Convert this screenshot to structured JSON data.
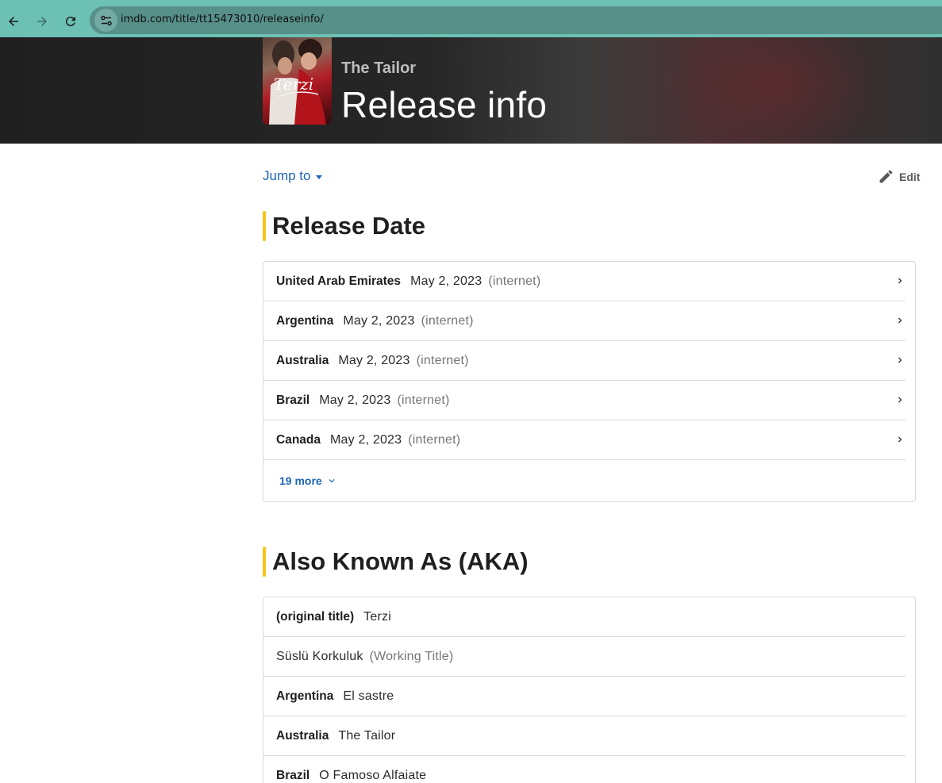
{
  "browser": {
    "url": "imdb.com/title/tt15473010/releaseinfo/",
    "icons": [
      "back-arrow-icon",
      "forward-arrow-icon",
      "reload-icon",
      "site-info-icon"
    ]
  },
  "hero": {
    "subtitle": "The Tailor",
    "title": "Release info",
    "poster_text": "Terzi"
  },
  "toolbar": {
    "jump_label": "Jump to",
    "edit_label": "Edit"
  },
  "release_date": {
    "heading": "Release Date",
    "rows": [
      {
        "country": "United Arab Emirates",
        "date": "May 2, 2023",
        "attr": "(internet)"
      },
      {
        "country": "Argentina",
        "date": "May 2, 2023",
        "attr": "(internet)"
      },
      {
        "country": "Australia",
        "date": "May 2, 2023",
        "attr": "(internet)"
      },
      {
        "country": "Brazil",
        "date": "May 2, 2023",
        "attr": "(internet)"
      },
      {
        "country": "Canada",
        "date": "May 2, 2023",
        "attr": "(internet)"
      }
    ],
    "more_label": "19 more"
  },
  "aka": {
    "heading": "Also Known As (AKA)",
    "rows": [
      {
        "label": "(original title)",
        "value": "Terzi",
        "attr": ""
      },
      {
        "label": "",
        "value": "Süslü Korkuluk",
        "attr": "(Working Title)"
      },
      {
        "label": "Argentina",
        "value": "El sastre",
        "attr": ""
      },
      {
        "label": "Australia",
        "value": "The Tailor",
        "attr": ""
      },
      {
        "label": "Brazil",
        "value": "O Famoso Alfaiate",
        "attr": ""
      }
    ]
  },
  "colors": {
    "browser_bar": "#6cc0b4",
    "omnibox": "#578f89",
    "link": "#1e64b4",
    "accent_bar": "#f5c518"
  }
}
